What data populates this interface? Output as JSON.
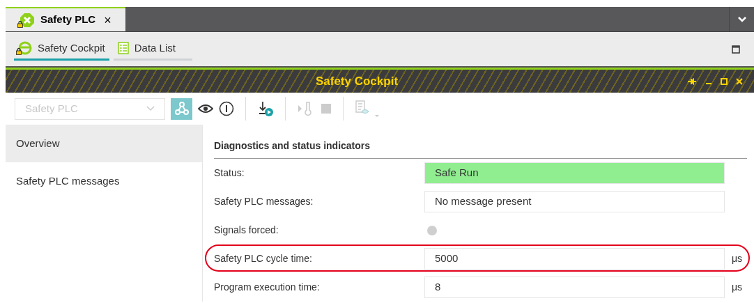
{
  "editor_tabs": [
    {
      "label": "Safety PLC",
      "close": "×",
      "selected": true
    }
  ],
  "view_tabs": [
    {
      "label": "Safety Cockpit",
      "selected": true,
      "kind": "cockpit"
    },
    {
      "label": "Data List",
      "selected": false,
      "kind": "list"
    }
  ],
  "panel": {
    "title": "Safety Cockpit"
  },
  "toolbar": {
    "device_select": {
      "value": "Safety PLC",
      "disabled": true
    }
  },
  "sidebar": {
    "items": [
      {
        "label": "Overview",
        "selected": true
      },
      {
        "label": "Safety PLC messages",
        "selected": false
      }
    ]
  },
  "section": {
    "title": "Diagnostics and status indicators",
    "rows": [
      {
        "kind": "field",
        "label": "Status:",
        "value": "Safe Run",
        "color": "#90ee90",
        "highlighted": false
      },
      {
        "kind": "field",
        "label": "Safety PLC messages:",
        "value": "No message present",
        "color": "#ffffff",
        "highlighted": false
      },
      {
        "kind": "indicator",
        "label": "Signals forced:",
        "on": false,
        "highlighted": false
      },
      {
        "kind": "field",
        "label": "Safety PLC cycle time:",
        "value": "5000",
        "unit": "μs",
        "color": "#ffffff",
        "highlighted": true
      },
      {
        "kind": "field",
        "label": "Program execution time:",
        "value": "8",
        "unit": "μs",
        "color": "#ffffff",
        "highlighted": false
      }
    ]
  }
}
